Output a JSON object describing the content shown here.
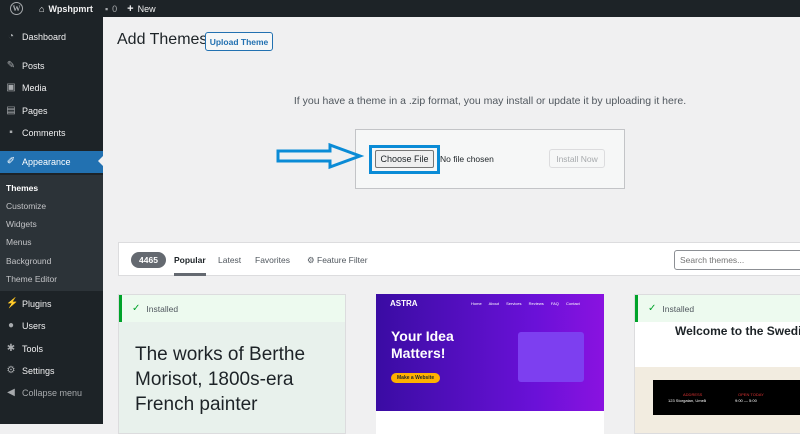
{
  "adminbar": {
    "site": "Wpshpmrt",
    "comments": "0",
    "new": "New"
  },
  "sidebar": {
    "items": [
      {
        "label": "Dashboard",
        "icon": "dashboard-icon"
      },
      {
        "label": "Posts",
        "icon": "pin-icon"
      },
      {
        "label": "Media",
        "icon": "media-icon"
      },
      {
        "label": "Pages",
        "icon": "pages-icon"
      },
      {
        "label": "Comments",
        "icon": "comment-icon"
      },
      {
        "label": "Appearance",
        "icon": "brush-icon"
      },
      {
        "label": "Plugins",
        "icon": "plugin-icon"
      },
      {
        "label": "Users",
        "icon": "users-icon"
      },
      {
        "label": "Tools",
        "icon": "wrench-icon"
      },
      {
        "label": "Settings",
        "icon": "settings-icon"
      },
      {
        "label": "Collapse menu",
        "icon": "collapse-icon"
      }
    ],
    "submenu": [
      "Themes",
      "Customize",
      "Widgets",
      "Menus",
      "Background",
      "Theme Editor"
    ]
  },
  "page": {
    "title": "Add Themes",
    "upload_button": "Upload Theme",
    "help": "If you have a theme in a .zip format, you may install or update it by uploading it here.",
    "choose_file": "Choose File",
    "no_file": "No file chosen",
    "install_now": "Install Now"
  },
  "filter": {
    "count": "4465",
    "tabs": [
      "Popular",
      "Latest",
      "Favorites",
      "Feature Filter"
    ],
    "search_placeholder": "Search themes..."
  },
  "cards": [
    {
      "installed": "Installed",
      "text": "The works of Berthe Morisot, 1800s-era French painter"
    },
    {
      "brand": "ASTRA",
      "nav": [
        "Home",
        "About",
        "Services",
        "Reviews",
        "FAQ",
        "Contact"
      ],
      "headline": "Your Idea Matters!",
      "cta": "Make a Website"
    },
    {
      "installed": "Installed",
      "headline": "Welcome to the Swedish Museum of Modern Art",
      "address_label": "ADDRESS",
      "address": "123 Storgatan, Umeå",
      "hours_label": "OPEN TODAY",
      "hours": "9:00 — 5:00"
    }
  ],
  "colors": {
    "accent": "#2271b1",
    "highlight": "#0a8bd6",
    "astra": "#5b14d6"
  }
}
